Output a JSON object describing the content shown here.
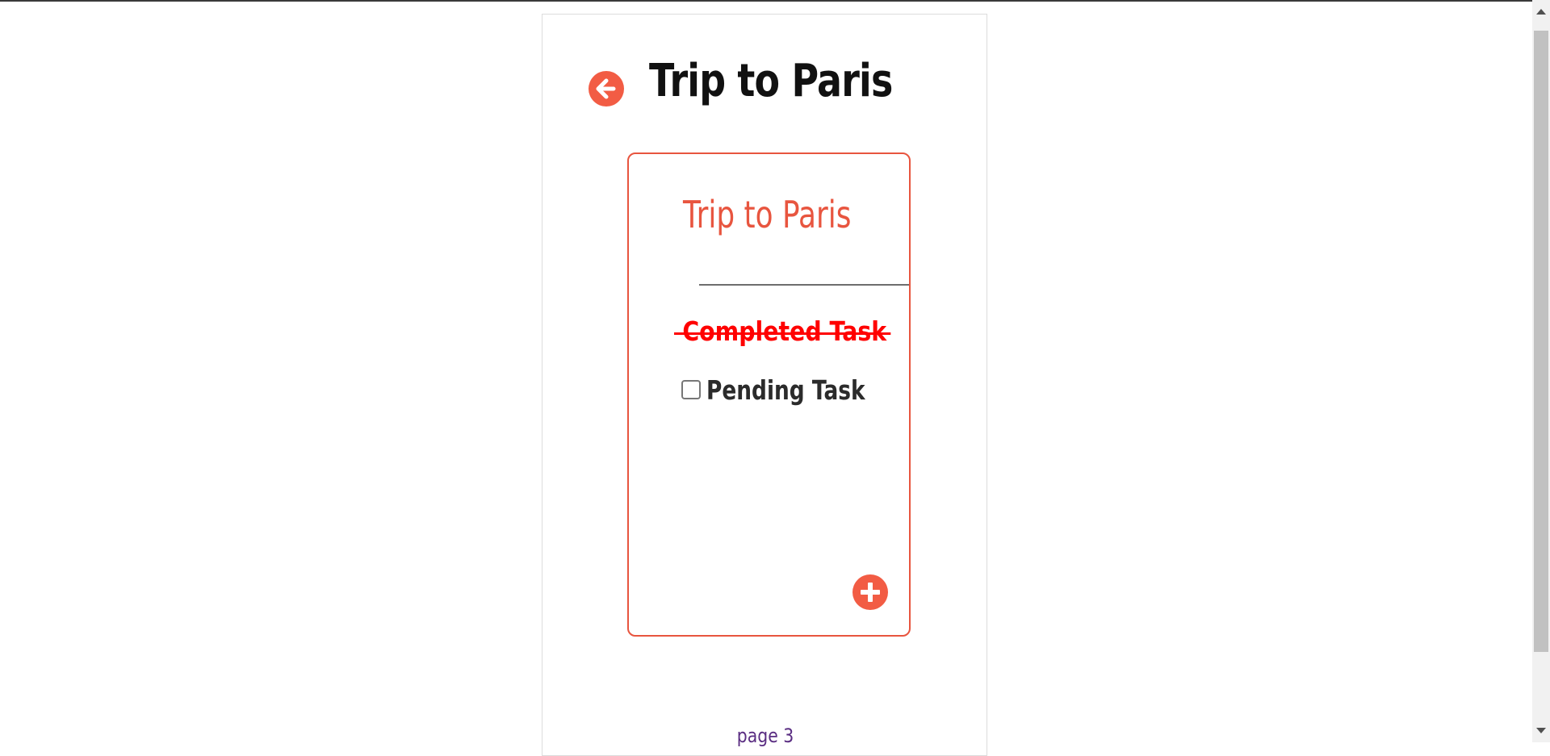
{
  "header": {
    "title": "Trip to Paris",
    "back_icon": "arrow-left-circle-icon"
  },
  "list_card": {
    "title": "Trip to Paris",
    "accent_color": "#f25c44",
    "tasks": [
      {
        "label": "Completed Task",
        "completed": true
      },
      {
        "label": "Pending Task",
        "completed": false
      }
    ],
    "add_icon": "plus-circle-icon"
  },
  "footer": {
    "page_label": "page 3"
  }
}
